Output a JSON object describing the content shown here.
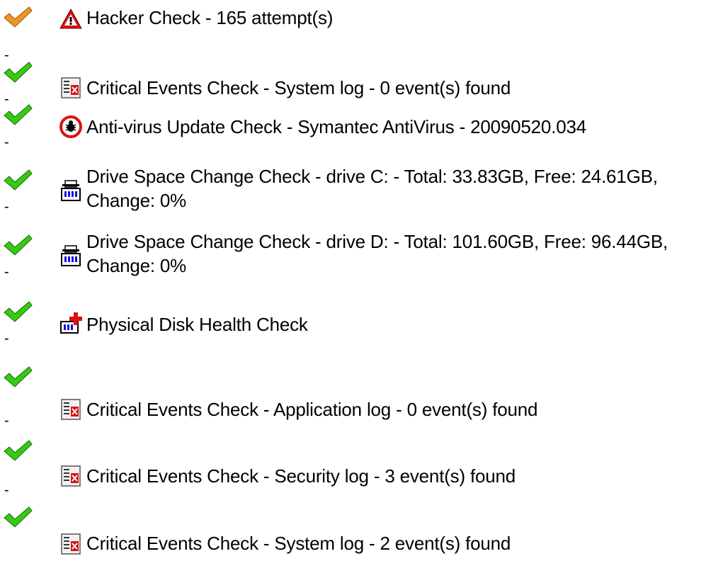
{
  "colors": {
    "ok": "#33cc11",
    "warning": "#f0961e",
    "alert": "#e01010",
    "disk_blue": "#1010e0"
  },
  "separator": "-",
  "checks": [
    {
      "status": "warning",
      "status_icon": "warning-check-icon",
      "type_icon": "warning-triangle-icon",
      "text": "Hacker Check - 165 attempt(s)"
    },
    {
      "status": "ok",
      "status_icon": "green-check-icon",
      "type_icon": "event-log-icon",
      "text": "Critical Events Check - System log - 0 event(s) found"
    },
    {
      "status": "ok",
      "status_icon": "green-check-icon",
      "type_icon": "virus-icon",
      "text": "Anti-virus Update Check - Symantec AntiVirus - 20090520.034"
    },
    {
      "status": "ok",
      "status_icon": "green-check-icon",
      "type_icon": "drive-icon",
      "text_line1": "Drive Space Change Check - drive C: - Total: 33.83GB, Free: 24.61GB,",
      "text_line2": "Change: 0%"
    },
    {
      "status": "ok",
      "status_icon": "green-check-icon",
      "type_icon": "drive-icon",
      "text_line1": "Drive Space Change Check - drive D: - Total: 101.60GB, Free: 96.44GB,",
      "text_line2": "Change: 0%"
    },
    {
      "status": "ok",
      "status_icon": "green-check-icon",
      "type_icon": "disk-health-icon",
      "text": "Physical Disk Health Check"
    },
    {
      "status": "ok",
      "status_icon": "green-check-icon",
      "type_icon": "event-log-icon",
      "text": "Critical Events Check - Application log - 0 event(s) found"
    },
    {
      "status": "ok",
      "status_icon": "green-check-icon",
      "type_icon": "event-log-icon",
      "text": "Critical Events Check - Security log - 3 event(s) found"
    },
    {
      "status": "ok",
      "status_icon": "green-check-icon",
      "type_icon": "event-log-icon",
      "text": "Critical Events Check - System log - 2 event(s) found"
    }
  ]
}
